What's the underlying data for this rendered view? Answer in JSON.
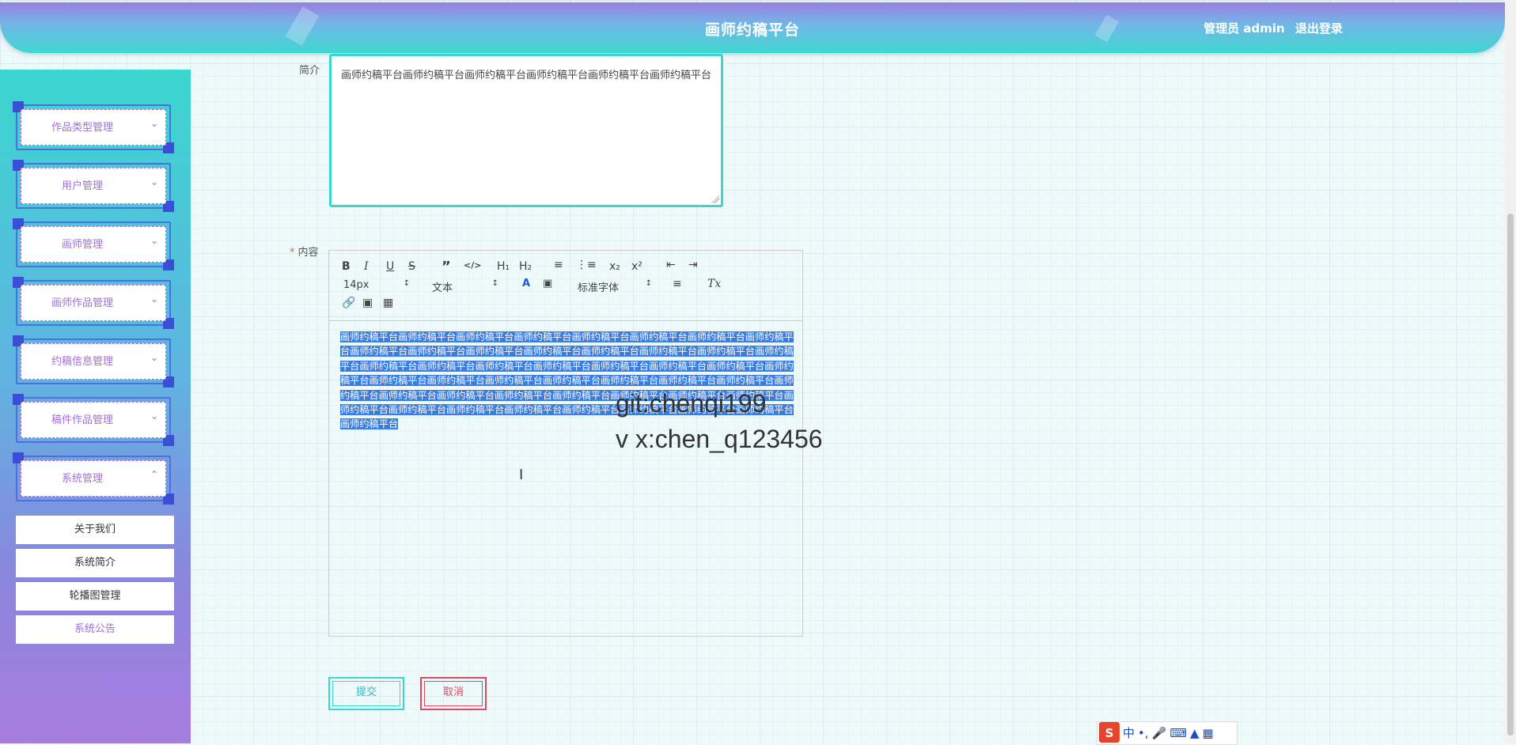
{
  "header": {
    "title": "画师约稿平台",
    "user_role": "管理员 admin",
    "logout": "退出登录"
  },
  "sidebar": {
    "items": [
      {
        "label": "作品类型管理",
        "icon": "chevron-down-icon"
      },
      {
        "label": "用户管理",
        "icon": "chevron-down-icon"
      },
      {
        "label": "画师管理",
        "icon": "chevron-down-icon"
      },
      {
        "label": "画师作品管理",
        "icon": "chevron-down-icon"
      },
      {
        "label": "约稿信息管理",
        "icon": "chevron-down-icon"
      },
      {
        "label": "稿件作品管理",
        "icon": "chevron-down-icon"
      },
      {
        "label": "系统管理",
        "icon": "chevron-up-icon"
      }
    ],
    "subitems": [
      "关于我们",
      "系统简介",
      "轮播图管理",
      "系统公告"
    ]
  },
  "form": {
    "intro_label": "简介",
    "intro_value": "画师约稿平台画师约稿平台画师约稿平台画师约稿平台画师约稿平台画师约稿平台",
    "content_label": "内容",
    "content_text": "画师约稿平台画师约稿平台画师约稿平台画师约稿平台画师约稿平台画师约稿平台画师约稿平台画师约稿平台画师约稿平台画师约稿平台画师约稿平台画师约稿平台画师约稿平台画师约稿平台画师约稿平台画师约稿平台画师约稿平台画师约稿平台画师约稿平台画师约稿平台画师约稿平台画师约稿平台画师约稿平台画师约稿平台画师约稿平台画师约稿平台画师约稿平台画师约稿平台画师约稿平台画师约稿平台画师约稿平台画师约稿平台画师约稿平台画师约稿平台画师约稿平台画师约稿平台画师约稿平台画师约稿平台画师约稿平台画师约稿平台画师约稿平台画师约稿平台画师约稿平台画师约稿平台画师约稿平台画师约稿平台画师约稿平台画师约稿平台",
    "submit": "提交",
    "cancel": "取消"
  },
  "editor_toolbar": {
    "bold": "B",
    "italic": "I",
    "underline": "U",
    "strike": "S",
    "h1": "H₁",
    "h2": "H₂",
    "sub": "x₂",
    "sup": "x²",
    "size": "14px",
    "text_type": "文本",
    "font": "标准字体",
    "color_a": "A",
    "clear": "Tx"
  },
  "overlay": {
    "line1": "git:chenqi199",
    "line2": "v x:chen_q123456"
  },
  "ime": {
    "logo": "S",
    "lang": "中",
    "punct": "•,"
  }
}
